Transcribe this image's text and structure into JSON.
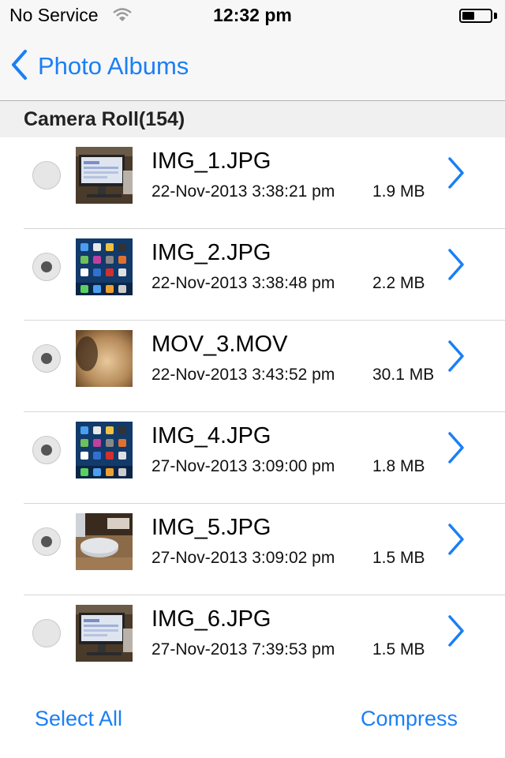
{
  "status": {
    "carrier": "No Service",
    "time": "12:32 pm",
    "battery_level": 0.45,
    "wifi_icon": "wifi-icon"
  },
  "nav": {
    "back_label": "Photo Albums",
    "back_icon": "chevron-left-icon"
  },
  "section": {
    "title": "Camera Roll(154)"
  },
  "files": [
    {
      "name": "IMG_1.JPG",
      "date": "22-Nov-2013 3:38:21 pm",
      "size": "1.9 MB",
      "selected": false,
      "thumb": "desk-monitor"
    },
    {
      "name": "IMG_2.JPG",
      "date": "22-Nov-2013 3:38:48 pm",
      "size": "2.2 MB",
      "selected": true,
      "thumb": "homescreen"
    },
    {
      "name": "MOV_3.MOV",
      "date": "22-Nov-2013 3:43:52 pm",
      "size": "30.1 MB",
      "selected": true,
      "thumb": "blur"
    },
    {
      "name": "IMG_4.JPG",
      "date": "27-Nov-2013 3:09:00 pm",
      "size": "1.8 MB",
      "selected": true,
      "thumb": "homescreen"
    },
    {
      "name": "IMG_5.JPG",
      "date": "27-Nov-2013 3:09:02 pm",
      "size": "1.5 MB",
      "selected": true,
      "thumb": "mac-mini"
    },
    {
      "name": "IMG_6.JPG",
      "date": "27-Nov-2013 7:39:53 pm",
      "size": "1.5 MB",
      "selected": false,
      "thumb": "desk-monitor"
    }
  ],
  "toolbar": {
    "select_all_label": "Select All",
    "compress_label": "Compress"
  },
  "colors": {
    "accent": "#1a7ff5",
    "separator": "#d6d6d6"
  }
}
